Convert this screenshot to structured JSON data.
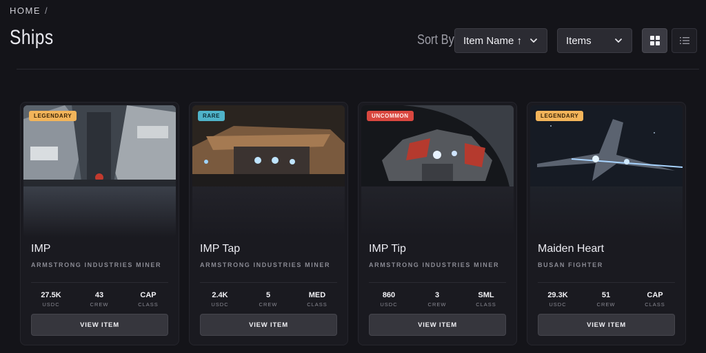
{
  "breadcrumb": {
    "home": "HOME",
    "separator": "/"
  },
  "page": {
    "title": "Ships"
  },
  "toolbar": {
    "sort_label": "Sort By",
    "sort_value": "Item Name ↑",
    "filter_value": "Items",
    "grid_icon": "grid-view-icon",
    "list_icon": "list-view-icon"
  },
  "colors": {
    "legendary": "#f2b45a",
    "rare": "#4fb3c9",
    "uncommon": "#d9473f"
  },
  "cards": [
    {
      "rarity": "LEGENDARY",
      "name": "IMP",
      "subtitle": "ARMSTRONG INDUSTRIES MINER",
      "stats": [
        {
          "value": "27.5K",
          "label": "USDC"
        },
        {
          "value": "43",
          "label": "CREW"
        },
        {
          "value": "CAP",
          "label": "CLASS"
        }
      ],
      "button": "VIEW ITEM"
    },
    {
      "rarity": "RARE",
      "name": "IMP Tap",
      "subtitle": "ARMSTRONG INDUSTRIES MINER",
      "stats": [
        {
          "value": "2.4K",
          "label": "USDC"
        },
        {
          "value": "5",
          "label": "CREW"
        },
        {
          "value": "MED",
          "label": "CLASS"
        }
      ],
      "button": "VIEW ITEM"
    },
    {
      "rarity": "UNCOMMON",
      "name": "IMP Tip",
      "subtitle": "ARMSTRONG INDUSTRIES MINER",
      "stats": [
        {
          "value": "860",
          "label": "USDC"
        },
        {
          "value": "3",
          "label": "CREW"
        },
        {
          "value": "SML",
          "label": "CLASS"
        }
      ],
      "button": "VIEW ITEM"
    },
    {
      "rarity": "LEGENDARY",
      "name": "Maiden Heart",
      "subtitle": "BUSAN FIGHTER",
      "stats": [
        {
          "value": "29.3K",
          "label": "USDC"
        },
        {
          "value": "51",
          "label": "CREW"
        },
        {
          "value": "CAP",
          "label": "CLASS"
        }
      ],
      "button": "VIEW ITEM"
    }
  ]
}
